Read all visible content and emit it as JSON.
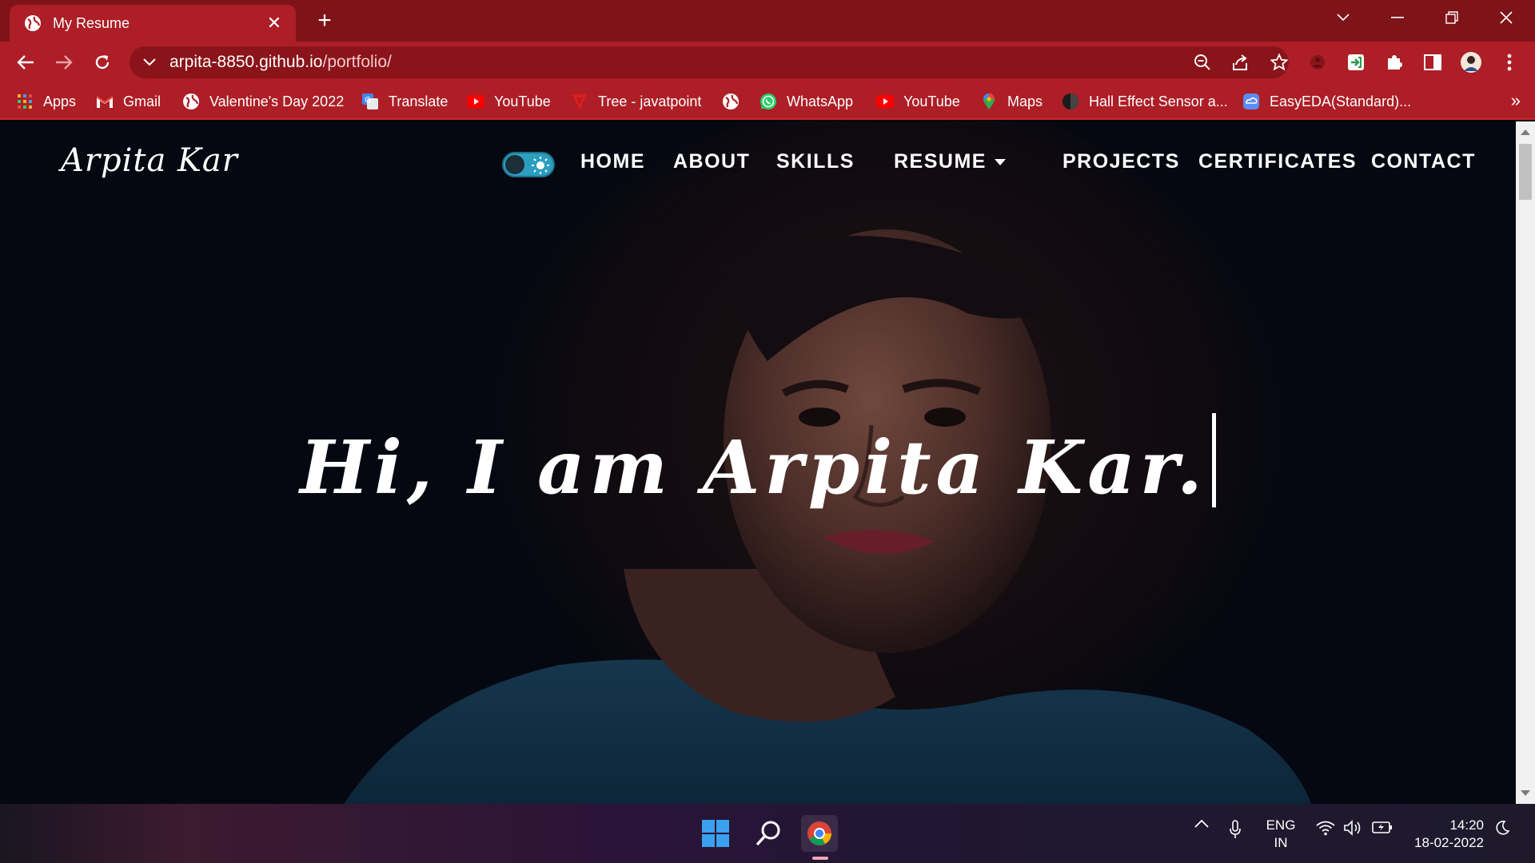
{
  "browser": {
    "tab_title": "My Resume",
    "tab_close": "✕",
    "new_tab": "+",
    "url_host": "arpita-8850.github.io",
    "url_path": "/portfolio/",
    "bookmarks": [
      {
        "label": "Apps",
        "icon": "apps-grid-icon"
      },
      {
        "label": "Gmail",
        "icon": "gmail-icon"
      },
      {
        "label": "Valentine's Day 2022",
        "icon": "globe-icon"
      },
      {
        "label": "Translate",
        "icon": "google-translate-icon"
      },
      {
        "label": "YouTube",
        "icon": "youtube-icon"
      },
      {
        "label": "Tree - javatpoint",
        "icon": "javatpoint-icon"
      },
      {
        "label": "",
        "icon": "globe-icon"
      },
      {
        "label": "WhatsApp",
        "icon": "whatsapp-icon"
      },
      {
        "label": "YouTube",
        "icon": "youtube-icon"
      },
      {
        "label": "Maps",
        "icon": "maps-pin-icon"
      },
      {
        "label": "Hall Effect Sensor a...",
        "icon": "site-icon"
      },
      {
        "label": "EasyEDA(Standard)...",
        "icon": "easyeda-icon"
      }
    ],
    "bookmarks_more": "»"
  },
  "site": {
    "brand": "Arpita Kar",
    "nav": {
      "home": "HOME",
      "about": "ABOUT",
      "skills": "SKILLS",
      "resume": "RESUME",
      "projects": "PROJECTS",
      "certificates": "CERTIFICATES",
      "contact": "CONTACT"
    },
    "hero_text": "Hi, I am Arpita Kar."
  },
  "taskbar": {
    "lang_line1": "ENG",
    "lang_line2": "IN",
    "time": "14:20",
    "date": "18-02-2022"
  },
  "colors": {
    "tabstrip": "#7e1418",
    "toolbar": "#ad1e26",
    "omnibox": "#8b131a",
    "toggle": "#2c9ec0"
  }
}
